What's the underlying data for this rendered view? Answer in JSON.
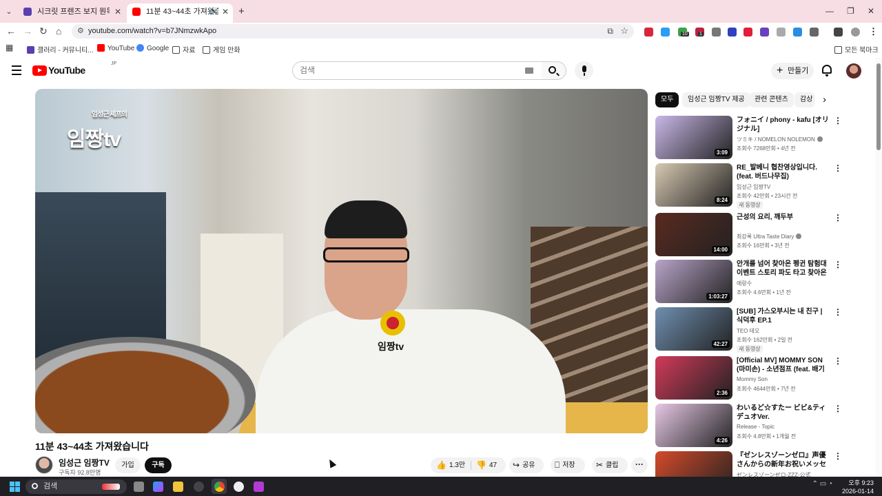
{
  "browser": {
    "tabs": [
      {
        "title": "시크릿 프렌즈 보지 뭔득 쿠키",
        "active": false
      },
      {
        "title": "11분 43~44초 가져왔습니다",
        "active": true
      }
    ],
    "url": "youtube.com/watch?v=b7JNmzwkApo",
    "bookmarks": [
      {
        "label": "갤러리 - 커뮤니티..."
      },
      {
        "label": "YouTube"
      },
      {
        "label": "Google"
      },
      {
        "label": "자료"
      },
      {
        "label": "게임 만화"
      }
    ],
    "all_bookmarks": "모든 북마크",
    "extension_badges": [
      "10",
      "1"
    ]
  },
  "youtube": {
    "logo": "YouTube",
    "region": "JP",
    "search_placeholder": "검색",
    "create_label": "만들기"
  },
  "player": {
    "watermark_small": "임성근 셰프의",
    "watermark": "임짱tv",
    "apron_logo": "임짱tv"
  },
  "video": {
    "title": "11분 43~44초 가져왔습니다",
    "channel": "임성근 임짱TV",
    "subscribers": "구독자 92.8만명",
    "join": "가입",
    "subscribe": "구독",
    "likes": "1.3만",
    "dislikes": "47",
    "share": "공유",
    "save": "저장",
    "clip": "클립"
  },
  "chips": [
    "모두",
    "임성근 임짱TV 제공",
    "관련 콘텐츠",
    "감상"
  ],
  "recommendations": [
    {
      "title": "フォニイ / phony - kafu [オリジナル]",
      "channel": "ツミキ / NOMELON NOLEMON",
      "verified": true,
      "meta": "조회수 7268만회 • 4년 전",
      "duration": "3:09",
      "thumb_color": "#c9b8e8",
      "badge": ""
    },
    {
      "title": "RE_발베니 협찬영상입니다. (feat. 버드나무집)",
      "channel": "임성근 임짱TV",
      "verified": false,
      "meta": "조회수 42만회 • 23시간 전",
      "duration": "8:24",
      "thumb_color": "#d8c9b2",
      "badge": "새 동영상"
    },
    {
      "title": "근성의 요리, 깨두부",
      "channel": "최강록 Ultra Taste Diary",
      "verified": true,
      "meta": "조회수 16만회 • 3년 전",
      "duration": "14:00",
      "thumb_color": "#5a2a20",
      "badge": ""
    },
    {
      "title": "안개를 넘어 찾아온 펭귄 탐험대 이벤트 스토리 파도 타고 찾아온 펭...",
      "channel": "애랑수",
      "verified": false,
      "meta": "조회수 4.6만회 • 1년 전",
      "duration": "1:03:27",
      "thumb_color": "#b8a4c8",
      "badge": ""
    },
    {
      "title": "[SUB] 가스오부시는 내 친구 | 식덕후 EP.1",
      "channel": "TEO 테오",
      "verified": false,
      "meta": "조회수 162만회 • 2일 전",
      "duration": "42:27",
      "thumb_color": "#6f8fb0",
      "badge": "새 동영상"
    },
    {
      "title": "[Official MV] MOMMY SON (마미손) - 소년점프 (feat. 배기성)",
      "channel": "Mommy Son",
      "verified": false,
      "meta": "조회수 4644만회 • 7년 전",
      "duration": "2:36",
      "thumb_color": "#d23a5a",
      "badge": ""
    },
    {
      "title": "わいるど☆すたー ビビ&ティデュオVer.",
      "channel": "Release - Topic",
      "verified": false,
      "meta": "조회수 4.8만회 • 1개월 전",
      "duration": "4:26",
      "thumb_color": "#e7c8e6",
      "badge": ""
    },
    {
      "title": "『ゼンレスゾーンゼロ』声優さんからの新年お祝いメッセー...",
      "channel": "ゼンレスゾーンゼロ-ZZZ-公式",
      "verified": false,
      "meta": "",
      "duration": "",
      "thumb_color": "#d44a2a",
      "badge": ""
    }
  ],
  "taskbar": {
    "search": "검색",
    "time": "오후 9:23",
    "date": "2026-01-14"
  }
}
